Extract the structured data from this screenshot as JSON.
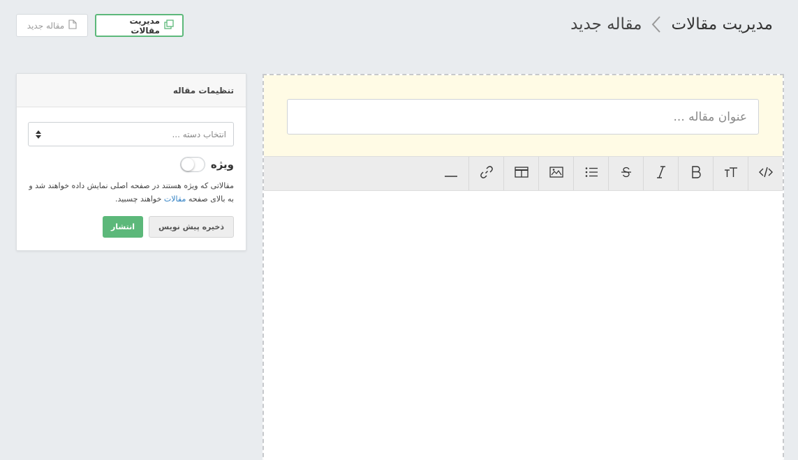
{
  "header": {
    "breadcrumb_root": "مدیریت مقالات",
    "breadcrumb_current": "مقاله جدید"
  },
  "top_actions": {
    "manage_label": "مدیریت مقالات",
    "new_label": "مقاله جدید"
  },
  "editor": {
    "title_placeholder": "عنوان مقاله ...",
    "toolbar": [
      {
        "name": "code-view",
        "icon": "code-icon"
      },
      {
        "name": "font-size",
        "icon": "text-size-icon"
      },
      {
        "name": "bold",
        "icon": "bold-icon"
      },
      {
        "name": "italic",
        "icon": "italic-icon"
      },
      {
        "name": "strikethrough",
        "icon": "strikethrough-icon"
      },
      {
        "name": "list",
        "icon": "list-icon"
      },
      {
        "name": "image",
        "icon": "image-icon"
      },
      {
        "name": "table",
        "icon": "table-icon"
      },
      {
        "name": "link",
        "icon": "link-icon"
      },
      {
        "name": "horizontal-rule",
        "icon": "horizontal-rule-icon"
      }
    ]
  },
  "settings": {
    "title": "تنظیمات مقاله",
    "category_placeholder": "انتخاب دسته ...",
    "featured_label": "ویژه",
    "featured_on": false,
    "help_before": "مقالاتی که ویژه هستند در صفحه اصلی نمایش داده خواهند شد و به بالای صفحه ",
    "help_link": "مقالات",
    "help_after": " خواهند چسبید.",
    "draft_label": "ذخیره پیش نویس",
    "publish_label": "انتشار"
  },
  "colors": {
    "accent_green": "#5cb87a",
    "title_area_bg": "#fffbe5",
    "link_blue": "#2f7fc3",
    "page_bg": "#e9ecef"
  }
}
